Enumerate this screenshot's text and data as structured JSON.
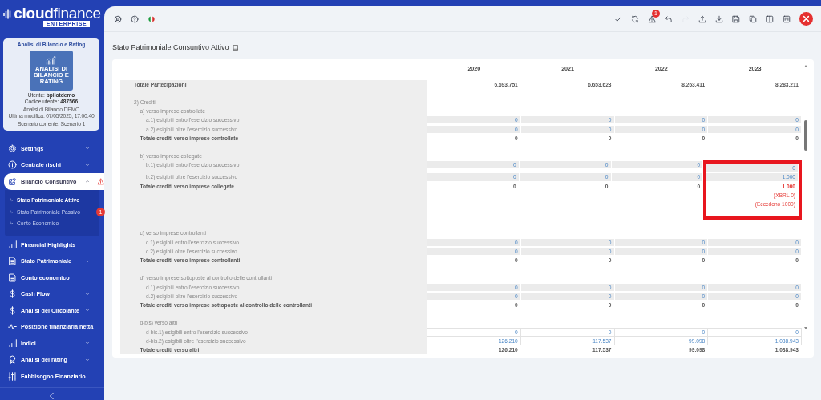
{
  "sidebar": {
    "logo": {
      "bold": "cloud",
      "light": "finance",
      "badge": "ENTERPRISE"
    },
    "profile": {
      "title": "Analisi di Bilancio e Rating",
      "tile_text": "ANALISI DI BILANCIO E RATING",
      "user": "Utente: **bpilotdemo**",
      "code": "Codice utente: **487566**",
      "details": [
        "Analisi di Bilancio DEMO",
        "Ultima modifica: 07/05/2025, 17:00:40"
      ],
      "scenario": "Scenario corrente: Scenario 1"
    },
    "nav": [
      {
        "label": "Settings",
        "kind": "gear",
        "expanded": false,
        "selected": false,
        "warning": false
      },
      {
        "label": "Centrale rischi",
        "kind": "info",
        "expanded": false,
        "selected": false,
        "warning": false
      },
      {
        "label": "Bilancio Consuntivo",
        "kind": "edit",
        "expanded": true,
        "selected": true,
        "warning": true,
        "children": [
          {
            "label": "Stato Patrimoniale Attivo",
            "selected": true
          },
          {
            "label": "Stato Patrimoniale Passivo",
            "selected": false,
            "badge": "1"
          },
          {
            "label": "Conto Economico",
            "selected": false
          }
        ]
      },
      {
        "label": "Financial Highlights",
        "kind": "bars",
        "selected": false,
        "warning": false
      },
      {
        "label": "Stato Patrimoniale",
        "kind": "doc",
        "expanded": false,
        "selected": false,
        "warning": false
      },
      {
        "label": "Conto economico",
        "kind": "doc",
        "selected": false,
        "warning": false
      },
      {
        "label": "Cash Flow",
        "kind": "dollar",
        "expanded": false,
        "selected": false,
        "warning": false
      },
      {
        "label": "Analisi del Circolante",
        "kind": "dollar",
        "expanded": false,
        "selected": false,
        "warning": false
      },
      {
        "label": "Posizione finanziaria netta",
        "kind": "pulse",
        "selected": false,
        "warning": false
      },
      {
        "label": "Indici",
        "kind": "bars",
        "expanded": false,
        "selected": false,
        "warning": false
      },
      {
        "label": "Analisi del rating",
        "kind": "award",
        "expanded": false,
        "selected": false,
        "warning": false
      },
      {
        "label": "Fabbisogno Finanziario",
        "kind": "sliders",
        "selected": false,
        "warning": false
      }
    ]
  },
  "toolbar": {
    "left": [
      {
        "kind": "lifebuoy"
      },
      {
        "kind": "help"
      },
      {
        "kind": "flag"
      }
    ],
    "right": [
      {
        "kind": "check",
        "disabled": false
      },
      {
        "kind": "refresh",
        "disabled": false
      },
      {
        "kind": "warning",
        "disabled": false,
        "badge": "1"
      },
      {
        "kind": "undo",
        "disabled": false
      },
      {
        "kind": "redo",
        "disabled": true
      },
      {
        "kind": "upload",
        "disabled": false
      },
      {
        "kind": "download",
        "disabled": false
      },
      {
        "kind": "save",
        "disabled": false
      },
      {
        "kind": "copy",
        "disabled": false
      },
      {
        "kind": "columns",
        "disabled": false
      },
      {
        "kind": "layout",
        "disabled": false
      },
      {
        "kind": "close"
      }
    ]
  },
  "page_title": "Stato Patrimoniale Consuntivo Attivo",
  "table": {
    "columns": [
      "2020",
      "2021",
      "2022",
      "2023"
    ],
    "rows": [
      {
        "kind": "total",
        "label": "Totale Partecipazioni",
        "highlighted": false,
        "cells": [
          {
            "text": "6.693.751",
            "error": false
          },
          {
            "text": "6.653.623",
            "error": false
          },
          {
            "text": "8.263.411",
            "error": false
          },
          {
            "text": "8.283.211",
            "error": false
          }
        ]
      },
      {
        "kind": "group",
        "label": "2) Crediti:",
        "children": [
          {
            "kind": "group",
            "label": "a) verso imprese controllate",
            "children": [
              {
                "kind": "input",
                "label": "a.1) esigibili entro l'esercizio successivo",
                "disabled": true,
                "highlighted": false,
                "cells": [
                  {
                    "text": "0",
                    "error": false
                  },
                  {
                    "text": "0",
                    "error": false
                  },
                  {
                    "text": "0",
                    "error": false
                  },
                  {
                    "text": "0",
                    "error": false
                  }
                ]
              },
              {
                "kind": "input",
                "label": "a.2) esigibili oltre l'esercizio successivo",
                "disabled": true,
                "highlighted": false,
                "cells": [
                  {
                    "text": "0",
                    "error": false
                  },
                  {
                    "text": "0",
                    "error": false
                  },
                  {
                    "text": "0",
                    "error": false
                  },
                  {
                    "text": "0",
                    "error": false
                  }
                ]
              }
            ]
          },
          {
            "kind": "total",
            "label": "Totale crediti verso imprese controllate",
            "highlighted": false,
            "cells": [
              {
                "text": "0",
                "error": false
              },
              {
                "text": "0",
                "error": false
              },
              {
                "text": "0",
                "error": false
              },
              {
                "text": "0",
                "error": false
              }
            ]
          },
          {
            "kind": "group",
            "label": "b) verso imprese collegate",
            "children": [
              {
                "kind": "input",
                "label": "b.1) esigibili entro l'esercizio successivo",
                "disabled": true,
                "highlighted": true,
                "cells": [
                  {
                    "text": "0",
                    "error": false
                  },
                  {
                    "text": "0",
                    "error": false
                  },
                  {
                    "text": "0",
                    "error": false
                  },
                  {
                    "text": "0",
                    "error": false
                  }
                ]
              },
              {
                "kind": "input",
                "label": "b.2) esigibili oltre l'esercizio successivo",
                "disabled": true,
                "highlighted": true,
                "cells": [
                  {
                    "text": "0",
                    "error": false
                  },
                  {
                    "text": "0",
                    "error": false
                  },
                  {
                    "text": "0",
                    "error": false
                  },
                  {
                    "text": "1.000",
                    "error": false
                  }
                ]
              }
            ]
          },
          {
            "kind": "total",
            "label": "Totale crediti verso imprese collegate",
            "highlighted": true,
            "cells": [
              {
                "text": "0",
                "error": false
              },
              {
                "text": "0",
                "error": false
              },
              {
                "text": "0",
                "error": false
              },
              {
                "text": "1.000",
                "error": true,
                "notes": [
                  "(XBRL 0)",
                  "(Eccedono 1000)"
                ]
              }
            ]
          },
          {
            "kind": "group",
            "label": "c) verso imprese controllanti",
            "children": [
              {
                "kind": "input",
                "label": "c.1) esigibili entro l'esercizio successivo",
                "disabled": true,
                "highlighted": false,
                "cells": [
                  {
                    "text": "0",
                    "error": false
                  },
                  {
                    "text": "0",
                    "error": false
                  },
                  {
                    "text": "0",
                    "error": false
                  },
                  {
                    "text": "0",
                    "error": false
                  }
                ]
              },
              {
                "kind": "input",
                "label": "c.2) esigibili oltre l'esercizio successivo",
                "disabled": true,
                "highlighted": false,
                "cells": [
                  {
                    "text": "0",
                    "error": false
                  },
                  {
                    "text": "0",
                    "error": false
                  },
                  {
                    "text": "0",
                    "error": false
                  },
                  {
                    "text": "0",
                    "error": false
                  }
                ]
              }
            ]
          },
          {
            "kind": "total",
            "label": "Totale crediti verso imprese controllanti",
            "highlighted": false,
            "cells": [
              {
                "text": "0",
                "error": false
              },
              {
                "text": "0",
                "error": false
              },
              {
                "text": "0",
                "error": false
              },
              {
                "text": "0",
                "error": false
              }
            ]
          },
          {
            "kind": "group",
            "label": "d) verso imprese sottoposte al controllo delle controllanti",
            "children": [
              {
                "kind": "input",
                "label": "d.1) esigibili entro l'esercizio successivo",
                "disabled": true,
                "highlighted": false,
                "cells": [
                  {
                    "text": "0",
                    "error": false
                  },
                  {
                    "text": "0",
                    "error": false
                  },
                  {
                    "text": "0",
                    "error": false
                  },
                  {
                    "text": "0",
                    "error": false
                  }
                ]
              },
              {
                "kind": "input",
                "label": "d.2) esigibili oltre l'esercizio successivo",
                "disabled": true,
                "highlighted": false,
                "cells": [
                  {
                    "text": "0",
                    "error": false
                  },
                  {
                    "text": "0",
                    "error": false
                  },
                  {
                    "text": "0",
                    "error": false
                  },
                  {
                    "text": "0",
                    "error": false
                  }
                ]
              }
            ]
          },
          {
            "kind": "total",
            "label": "Totale crediti verso imprese sottoposte al controllo delle controllanti",
            "highlighted": false,
            "cells": [
              {
                "text": "0",
                "error": false
              },
              {
                "text": "0",
                "error": false
              },
              {
                "text": "0",
                "error": false
              },
              {
                "text": "0",
                "error": false
              }
            ]
          },
          {
            "kind": "group",
            "label": "d-bis) verso altri",
            "children": [
              {
                "kind": "input",
                "label": "d-bis.1) esigibili entro l'esercizio successivo",
                "disabled": false,
                "highlighted": false,
                "cells": [
                  {
                    "text": "0",
                    "error": false
                  },
                  {
                    "text": "0",
                    "error": false
                  },
                  {
                    "text": "0",
                    "error": false
                  },
                  {
                    "text": "0",
                    "error": false
                  }
                ]
              },
              {
                "kind": "input",
                "label": "d-bis.2) esigibili oltre l'esercizio successivo",
                "disabled": false,
                "highlighted": false,
                "cells": [
                  {
                    "text": "126.210",
                    "error": false
                  },
                  {
                    "text": "117.537",
                    "error": false
                  },
                  {
                    "text": "99.098",
                    "error": false
                  },
                  {
                    "text": "1.088.943",
                    "error": false
                  }
                ]
              }
            ]
          },
          {
            "kind": "total",
            "label": "Totale crediti verso altri",
            "highlighted": false,
            "cells": [
              {
                "text": "126.210",
                "error": false
              },
              {
                "text": "117.537",
                "error": false
              },
              {
                "text": "99.098",
                "error": false
              },
              {
                "text": "1.088.943",
                "error": false
              }
            ]
          }
        ]
      }
    ]
  }
}
